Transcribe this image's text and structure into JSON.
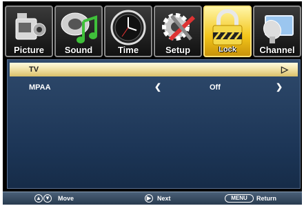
{
  "tabs": [
    {
      "label": "Picture",
      "icon": "camcorder-icon"
    },
    {
      "label": "Sound",
      "icon": "music-note-icon"
    },
    {
      "label": "Time",
      "icon": "clock-icon"
    },
    {
      "label": "Setup",
      "icon": "gear-icon"
    },
    {
      "label": "Lock",
      "icon": "padlock-icon",
      "active": true
    },
    {
      "label": "Channel",
      "icon": "satellite-dish-icon"
    }
  ],
  "rows": {
    "tv": {
      "label": "TV",
      "arrow": "▷"
    },
    "mpaa": {
      "label": "MPAA",
      "left_arrow": "❮",
      "value": "Off",
      "right_arrow": "❯"
    }
  },
  "footer": {
    "move_label": "Move",
    "next_label": "Next",
    "menu_key": "MENU",
    "return_label": "Return"
  },
  "colors": {
    "active_tab": "#f3c51a",
    "panel": "#1c3556",
    "selected_row": "#efe0a4"
  }
}
